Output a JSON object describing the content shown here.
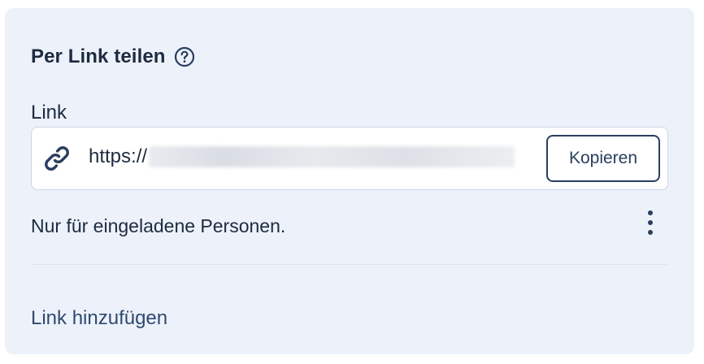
{
  "section": {
    "title": "Per Link teilen",
    "help_icon": "question-circle-icon"
  },
  "link_field": {
    "label": "Link",
    "icon": "link-icon",
    "url_visible": "https://",
    "url_redacted": true,
    "copy_label": "Kopieren"
  },
  "access": {
    "text": "Nur für eingeladene Personen.",
    "menu_icon": "more-vertical-icon"
  },
  "actions": {
    "add_link_label": "Link hinzufügen"
  },
  "colors": {
    "card_background": "#edf1f9",
    "text_primary": "#1c2b40",
    "accent": "#2a3f5f",
    "field_border": "#cdd6e6"
  }
}
